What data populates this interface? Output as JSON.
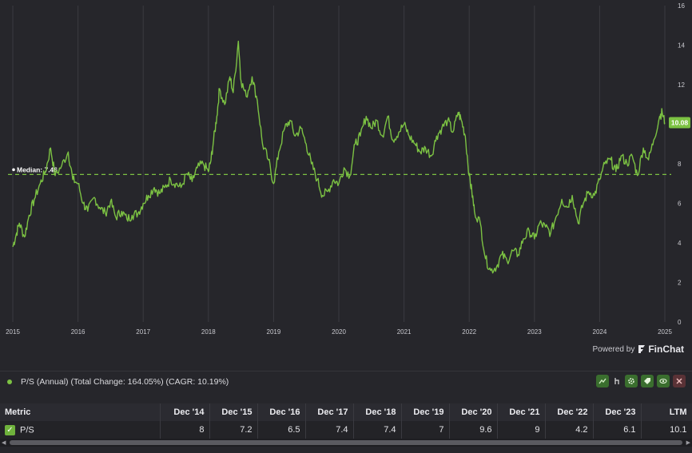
{
  "chart_data": {
    "type": "line",
    "title": "",
    "xlabel": "",
    "ylabel": "",
    "ylim": [
      0,
      16
    ],
    "yticks": [
      0,
      2,
      4,
      6,
      8,
      10,
      12,
      14,
      16
    ],
    "xticks": [
      "2015",
      "2016",
      "2017",
      "2018",
      "2019",
      "2020",
      "2021",
      "2022",
      "2023",
      "2024",
      "2025"
    ],
    "grid": true,
    "median": {
      "label": "Median: 7.46",
      "value": 7.46
    },
    "last_value_label": "10.08",
    "series": [
      {
        "name": "P/S (Annual)",
        "color": "#7cc243",
        "points": [
          [
            2015.0,
            3.8
          ],
          [
            2015.05,
            4.4
          ],
          [
            2015.1,
            5.0
          ],
          [
            2015.18,
            4.3
          ],
          [
            2015.25,
            5.4
          ],
          [
            2015.33,
            6.2
          ],
          [
            2015.42,
            7.0
          ],
          [
            2015.5,
            7.6
          ],
          [
            2015.58,
            8.8
          ],
          [
            2015.65,
            7.4
          ],
          [
            2015.75,
            7.9
          ],
          [
            2015.85,
            8.6
          ],
          [
            2015.92,
            7.2
          ],
          [
            2016.0,
            7.0
          ],
          [
            2016.08,
            6.0
          ],
          [
            2016.15,
            5.6
          ],
          [
            2016.25,
            6.3
          ],
          [
            2016.33,
            5.8
          ],
          [
            2016.42,
            5.5
          ],
          [
            2016.5,
            6.1
          ],
          [
            2016.58,
            5.3
          ],
          [
            2016.67,
            5.6
          ],
          [
            2016.75,
            5.2
          ],
          [
            2016.83,
            5.4
          ],
          [
            2016.92,
            5.5
          ],
          [
            2017.0,
            6.0
          ],
          [
            2017.08,
            6.4
          ],
          [
            2017.17,
            6.8
          ],
          [
            2017.25,
            6.5
          ],
          [
            2017.33,
            6.8
          ],
          [
            2017.42,
            7.2
          ],
          [
            2017.5,
            7.0
          ],
          [
            2017.58,
            6.8
          ],
          [
            2017.67,
            7.5
          ],
          [
            2017.75,
            7.1
          ],
          [
            2017.83,
            7.8
          ],
          [
            2017.92,
            8.0
          ],
          [
            2018.0,
            7.6
          ],
          [
            2018.04,
            8.2
          ],
          [
            2018.08,
            9.2
          ],
          [
            2018.13,
            10.4
          ],
          [
            2018.17,
            11.8
          ],
          [
            2018.25,
            11.0
          ],
          [
            2018.33,
            12.4
          ],
          [
            2018.38,
            11.6
          ],
          [
            2018.46,
            14.2
          ],
          [
            2018.5,
            12.2
          ],
          [
            2018.58,
            11.4
          ],
          [
            2018.67,
            12.4
          ],
          [
            2018.75,
            11.2
          ],
          [
            2018.83,
            9.0
          ],
          [
            2018.92,
            8.2
          ],
          [
            2019.0,
            7.0
          ],
          [
            2019.08,
            8.6
          ],
          [
            2019.17,
            9.8
          ],
          [
            2019.25,
            10.2
          ],
          [
            2019.33,
            9.4
          ],
          [
            2019.42,
            9.8
          ],
          [
            2019.5,
            9.0
          ],
          [
            2019.58,
            8.0
          ],
          [
            2019.67,
            7.2
          ],
          [
            2019.75,
            6.4
          ],
          [
            2019.83,
            6.6
          ],
          [
            2019.92,
            7.2
          ],
          [
            2020.0,
            7.0
          ],
          [
            2020.08,
            7.8
          ],
          [
            2020.17,
            7.4
          ],
          [
            2020.25,
            9.0
          ],
          [
            2020.33,
            9.4
          ],
          [
            2020.42,
            10.4
          ],
          [
            2020.5,
            9.8
          ],
          [
            2020.58,
            10.2
          ],
          [
            2020.67,
            9.4
          ],
          [
            2020.75,
            10.4
          ],
          [
            2020.83,
            9.2
          ],
          [
            2020.92,
            9.6
          ],
          [
            2021.0,
            10.0
          ],
          [
            2021.08,
            9.4
          ],
          [
            2021.17,
            9.0
          ],
          [
            2021.25,
            8.6
          ],
          [
            2021.33,
            8.8
          ],
          [
            2021.42,
            8.4
          ],
          [
            2021.5,
            9.4
          ],
          [
            2021.58,
            9.8
          ],
          [
            2021.67,
            10.2
          ],
          [
            2021.75,
            9.6
          ],
          [
            2021.83,
            10.6
          ],
          [
            2021.88,
            10.2
          ],
          [
            2021.94,
            9.4
          ],
          [
            2022.0,
            7.4
          ],
          [
            2022.04,
            6.6
          ],
          [
            2022.08,
            5.6
          ],
          [
            2022.17,
            5.0
          ],
          [
            2022.25,
            3.2
          ],
          [
            2022.33,
            2.6
          ],
          [
            2022.42,
            2.8
          ],
          [
            2022.5,
            3.4
          ],
          [
            2022.58,
            3.1
          ],
          [
            2022.67,
            3.6
          ],
          [
            2022.75,
            3.4
          ],
          [
            2022.83,
            4.2
          ],
          [
            2022.92,
            4.6
          ],
          [
            2023.0,
            4.2
          ],
          [
            2023.08,
            5.0
          ],
          [
            2023.17,
            4.8
          ],
          [
            2023.25,
            4.5
          ],
          [
            2023.33,
            5.3
          ],
          [
            2023.42,
            6.2
          ],
          [
            2023.5,
            5.8
          ],
          [
            2023.58,
            6.4
          ],
          [
            2023.67,
            5.0
          ],
          [
            2023.75,
            6.0
          ],
          [
            2023.83,
            6.6
          ],
          [
            2023.92,
            6.4
          ],
          [
            2024.0,
            7.2
          ],
          [
            2024.08,
            8.0
          ],
          [
            2024.17,
            8.2
          ],
          [
            2024.25,
            7.6
          ],
          [
            2024.33,
            8.4
          ],
          [
            2024.42,
            8.0
          ],
          [
            2024.5,
            8.4
          ],
          [
            2024.58,
            7.4
          ],
          [
            2024.67,
            8.8
          ],
          [
            2024.75,
            8.2
          ],
          [
            2024.83,
            9.2
          ],
          [
            2024.92,
            10.4
          ],
          [
            2024.96,
            10.6
          ],
          [
            2025.0,
            10.08
          ]
        ]
      }
    ]
  },
  "branding": {
    "powered_by": "Powered by",
    "brand": "FinChat"
  },
  "legend": {
    "text": "P/S (Annual) (Total Change: 164.05%) (CAGR: 10.19%)",
    "icons": [
      "chart-line-icon",
      "pointer-icon",
      "gear-icon",
      "tag-icon",
      "eye-icon",
      "close-icon"
    ]
  },
  "table": {
    "headers": [
      "Metric",
      "Dec '14",
      "Dec '15",
      "Dec '16",
      "Dec '17",
      "Dec '18",
      "Dec '19",
      "Dec '20",
      "Dec '21",
      "Dec '22",
      "Dec '23",
      "LTM"
    ],
    "rows": [
      {
        "metric": "P/S",
        "values": [
          "8",
          "7.2",
          "6.5",
          "7.4",
          "7.4",
          "7",
          "9.6",
          "9",
          "4.2",
          "6.1",
          "10.1"
        ]
      }
    ]
  },
  "colors": {
    "line": "#7cc243",
    "grid": "#3a3a40",
    "background": "#26262b"
  }
}
